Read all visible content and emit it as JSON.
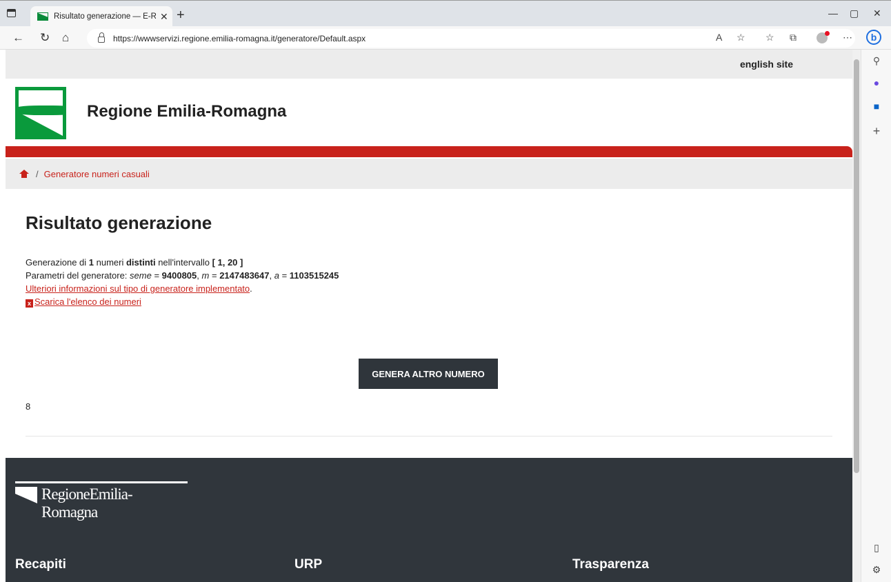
{
  "browser": {
    "tab_title": "Risultato generazione — E-R Il p",
    "url": "https://wwwservizi.regione.emilia-romagna.it/generatore/Default.aspx"
  },
  "site": {
    "english_link": "english site",
    "title": "Regione Emilia-Romagna",
    "breadcrumb_sep": "/",
    "breadcrumb_item": "Generatore numeri casuali"
  },
  "main": {
    "heading": "Risultato generazione",
    "gen_prefix": "Generazione di ",
    "gen_count": "1",
    "gen_mid": " numeri ",
    "gen_distinct": "distinti",
    "gen_interval_label": " nell'intervallo ",
    "gen_interval": "[ 1, 20 ]",
    "params_label": "Parametri del generatore: ",
    "seme_label": "seme",
    "seme_value": "9400805",
    "m_label": "m",
    "m_value": "2147483647",
    "a_label": "a",
    "a_value": "1103515245",
    "info_link": "Ulteriori informazioni sul tipo di generatore implementato",
    "download_link": "Scarica l'elenco dei numeri",
    "button_label": "GENERA ALTRO NUMERO",
    "result": "8"
  },
  "footer": {
    "logo_text": "RegioneEmilia-Romagna",
    "columns": [
      "Recapiti",
      "URP",
      "Trasparenza"
    ]
  },
  "colors": {
    "accent_red": "#c8221b",
    "brand_green": "#0a9a3c",
    "dark": "#30363c"
  }
}
